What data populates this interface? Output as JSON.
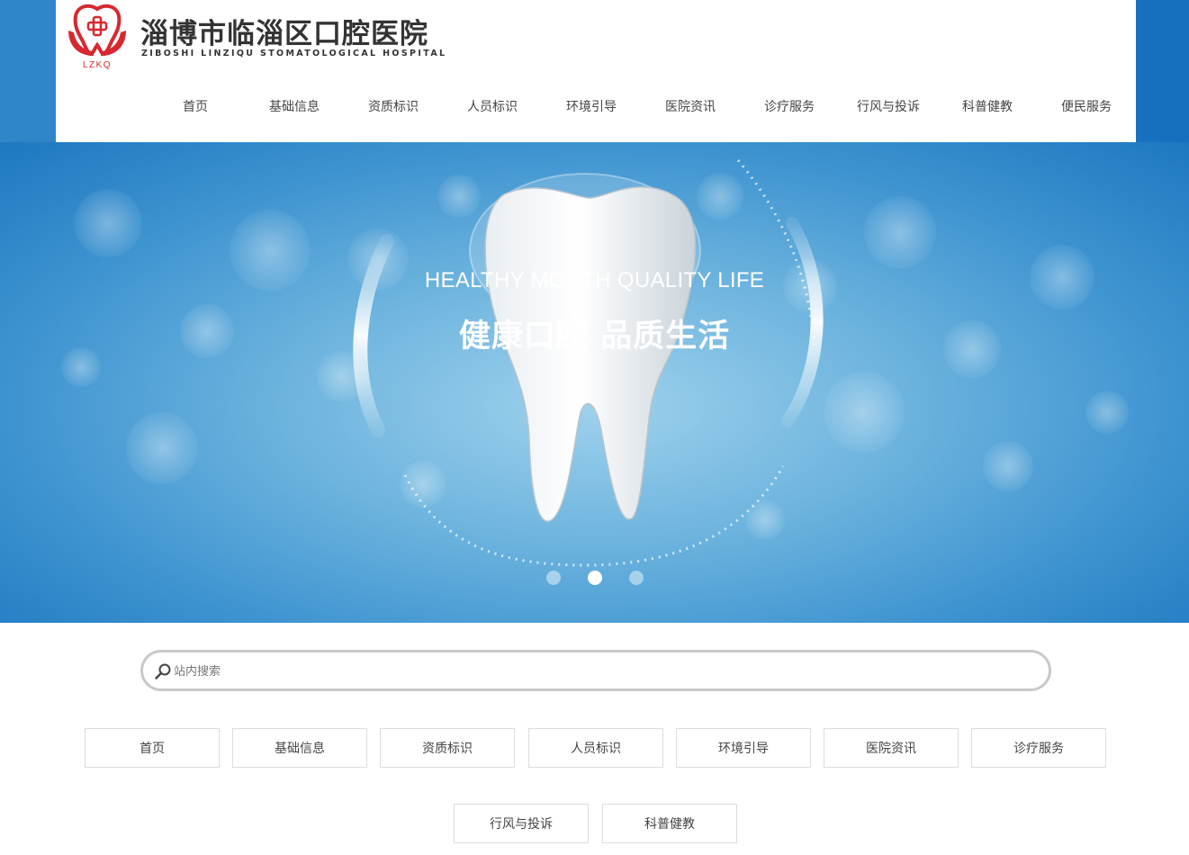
{
  "header": {
    "logo_text": "LZKQ",
    "title": "淄博市临淄区口腔医院",
    "subtitle": "ZIBOSHI LINZIQU STOMATOLOGICAL HOSPITAL",
    "nav": [
      "首页",
      "基础信息",
      "资质标识",
      "人员标识",
      "环境引导",
      "医院资讯",
      "诊疗服务",
      "行风与投诉",
      "科普健教",
      "便民服务"
    ]
  },
  "banner": {
    "headline_en": "HEALTHY MOUTH QUALITY LIFE",
    "headline_cn": "健康口腔 品质生活",
    "slides": 3,
    "active_slide": 2
  },
  "search": {
    "placeholder": "站内搜索",
    "value": "",
    "icon": "search-icon"
  },
  "quick_links": [
    "首页",
    "基础信息",
    "资质标识",
    "人员标识",
    "环境引导",
    "医院资讯",
    "诊疗服务",
    "行风与投诉",
    "科普健教"
  ],
  "colors": {
    "brand_blue": "#1f78c1",
    "logo_red": "#d7282f",
    "text": "#444444",
    "border": "#dcdcdc"
  }
}
